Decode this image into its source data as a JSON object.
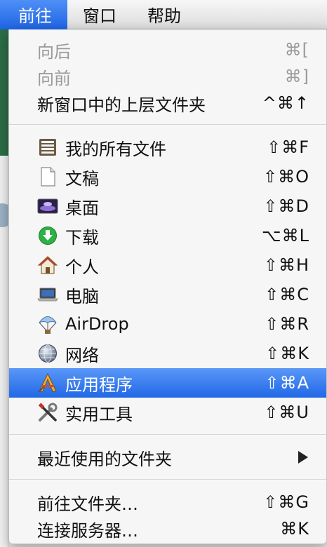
{
  "menubar": {
    "items": [
      "前往",
      "窗口",
      "帮助"
    ]
  },
  "go_menu": {
    "items": [
      {
        "label": "向后",
        "shortcut": "⌘[",
        "disabled": true
      },
      {
        "label": "向前",
        "shortcut": "⌘]",
        "disabled": true
      },
      {
        "label": "新窗口中的上层文件夹",
        "shortcut": "^⌘↑"
      },
      {
        "label": "我的所有文件",
        "shortcut": "⇧⌘F",
        "icon": "all-my-files-icon"
      },
      {
        "label": "文稿",
        "shortcut": "⇧⌘O",
        "icon": "document-icon"
      },
      {
        "label": "桌面",
        "shortcut": "⇧⌘D",
        "icon": "desktop-icon"
      },
      {
        "label": "下载",
        "shortcut": "⌥⌘L",
        "icon": "downloads-icon"
      },
      {
        "label": "个人",
        "shortcut": "⇧⌘H",
        "icon": "home-icon"
      },
      {
        "label": "电脑",
        "shortcut": "⇧⌘C",
        "icon": "computer-icon"
      },
      {
        "label": "AirDrop",
        "shortcut": "⇧⌘R",
        "icon": "airdrop-icon"
      },
      {
        "label": "网络",
        "shortcut": "⇧⌘K",
        "icon": "network-icon"
      },
      {
        "label": "应用程序",
        "shortcut": "⇧⌘A",
        "icon": "applications-icon",
        "highlighted": true
      },
      {
        "label": "实用工具",
        "shortcut": "⇧⌘U",
        "icon": "utilities-icon"
      },
      {
        "label": "最近使用的文件夹",
        "submenu": true
      },
      {
        "label": "前往文件夹…",
        "shortcut": "⇧⌘G"
      },
      {
        "label": "连接服务器…",
        "shortcut": "⌘K"
      }
    ]
  },
  "colors": {
    "highlight": "#2168e6",
    "disabled_text": "#9a9a9a"
  }
}
